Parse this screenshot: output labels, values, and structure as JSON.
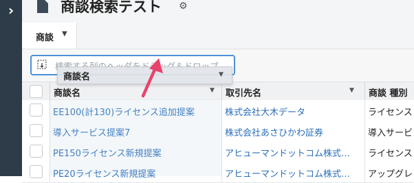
{
  "page": {
    "title": "商談検索テスト",
    "icons": {
      "rail": "chevron-right-icon",
      "page": "document-icon",
      "settings": "gear-icon"
    }
  },
  "toolbar": {
    "tab_label": "商談"
  },
  "group_panel": {
    "placeholder": "検索する列のヘッダをドラッグ＆ドロップ"
  },
  "drag_ghost": {
    "label": "商談名"
  },
  "grid": {
    "columns": [
      "商談名",
      "取引先名",
      "商談 種別"
    ],
    "rows": [
      {
        "name": "EE100(計130)ライセンス追加提案",
        "account": "株式会社大木データ",
        "type": "ライセンス"
      },
      {
        "name": "導入サービス提案7",
        "account": "株式会社あさひかわ証券",
        "type": "導入サービ"
      },
      {
        "name": "PE150ライセンス新規提案",
        "account": "アヒューマンドットコム株式…",
        "type": "ライセンス"
      },
      {
        "name": "PE20ライセンス新規提案",
        "account": "アヒューマンドットコム株式…",
        "type": "アップグレ"
      }
    ]
  },
  "colors": {
    "rail": "#2e3b48",
    "link": "#2a6ebb",
    "focus_border": "#4a90d9",
    "arrow": "#e8436b"
  }
}
